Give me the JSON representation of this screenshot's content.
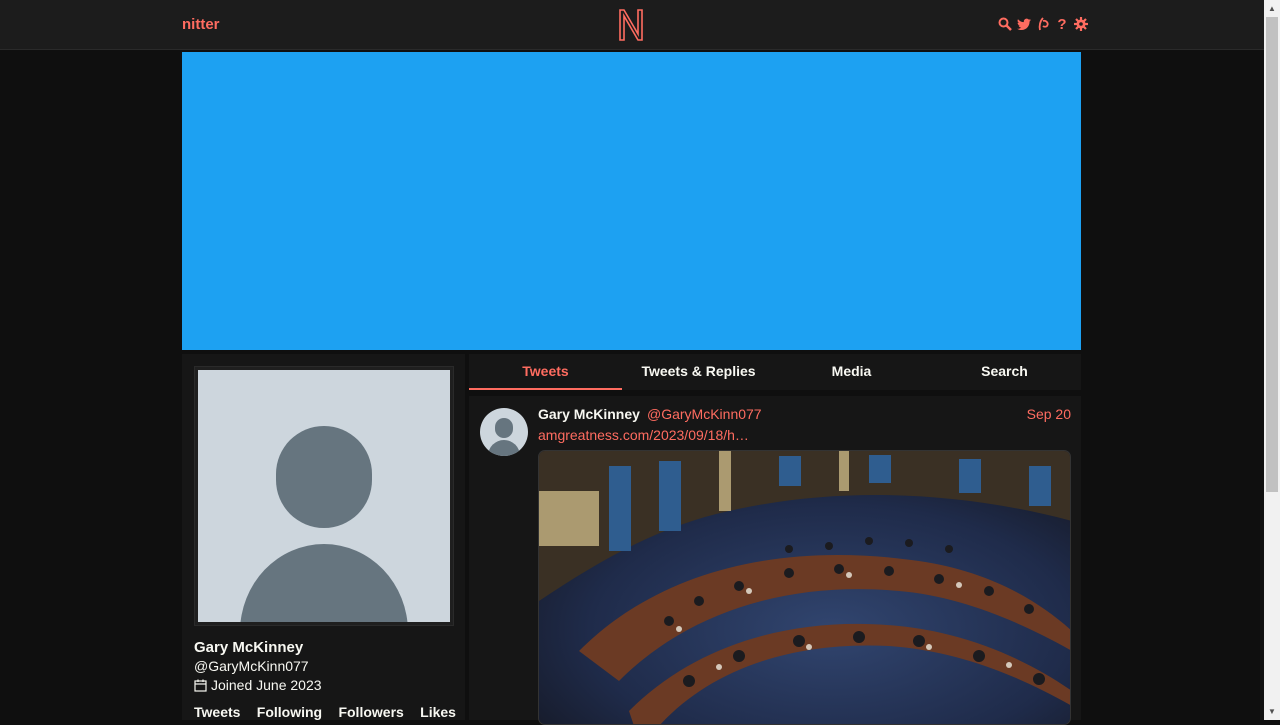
{
  "nav": {
    "brand": "nitter",
    "icons": [
      "search-icon",
      "twitter-icon",
      "rss-icon",
      "help-icon",
      "settings-icon"
    ]
  },
  "colors": {
    "accent": "#ff6c60",
    "banner": "#1da1f2",
    "background": "#0f0f0f",
    "panel": "#161616",
    "text": "#f8f8f2"
  },
  "profile": {
    "fullname": "Gary McKinney",
    "username": "@GaryMcKinn077",
    "joined": "Joined June 2023",
    "stats": [
      "Tweets",
      "Following",
      "Followers",
      "Likes"
    ]
  },
  "tabs": [
    "Tweets",
    "Tweets & Replies",
    "Media",
    "Search"
  ],
  "active_tab": "Tweets",
  "tweet": {
    "fullname": "Gary McKinney",
    "username": "@GaryMcKinn077",
    "date": "Sep 20",
    "link": "amgreatness.com/2023/09/18/h…"
  }
}
